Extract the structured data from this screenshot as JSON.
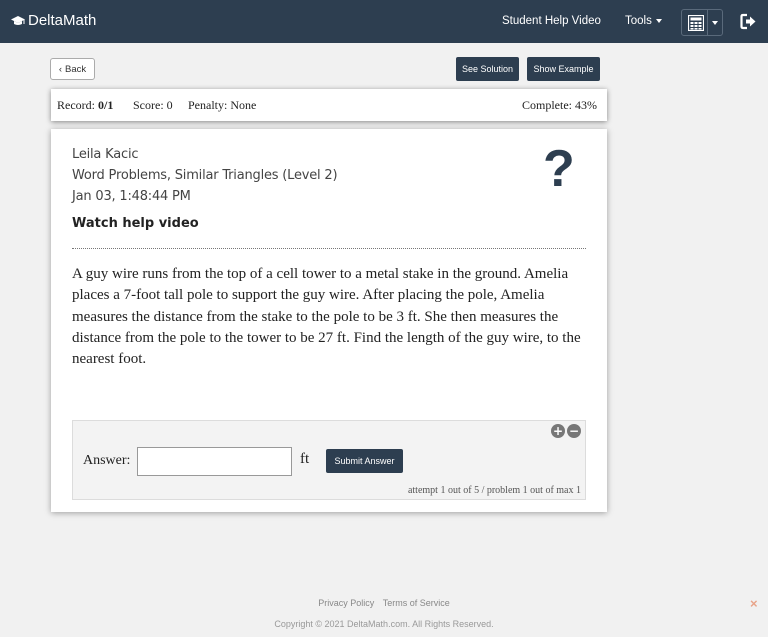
{
  "navbar": {
    "brand": "DeltaMath",
    "student_help_video": "Student Help Video",
    "tools": "Tools"
  },
  "toolbar": {
    "back": "Back",
    "see_solution": "See Solution",
    "show_example": "Show Example"
  },
  "record": {
    "record_label": "Record:",
    "record_value": "0/1",
    "score": "Score: 0",
    "penalty": "Penalty: None",
    "complete": "Complete: 43%"
  },
  "problem": {
    "student_name": "Leila Kacic",
    "topic": "Word Problems, Similar Triangles (Level 2)",
    "date": "Jan 03, 1:48:44 PM",
    "watch_help": "Watch help video",
    "question_icon": "?",
    "text": "A guy wire runs from the top of a cell tower to a metal stake in the ground. Amelia places a 7-foot tall pole to support the guy wire. After placing the pole, Amelia measures the distance from the stake to the pole to be 3 ft. She then measures the distance from the pole to the tower to be 27 ft. Find the length of the guy wire, to the nearest foot."
  },
  "answer": {
    "label": "Answer:",
    "value": "",
    "unit": "ft",
    "submit": "Submit Answer",
    "attempt_info": "attempt 1 out of 5 / problem 1 out of max 1"
  },
  "footer": {
    "privacy": "Privacy Policy",
    "terms": "Terms of Service",
    "copyright": "Copyright © 2021 DeltaMath.com. All Rights Reserved."
  },
  "colors": {
    "navbar_bg": "#2d3e50",
    "button_dark": "#2d3e50",
    "page_bg": "#f1f1f1"
  },
  "icons": [
    "graduation-cap-icon",
    "calculator-icon",
    "logout-icon",
    "chevron-left-icon",
    "question-mark-icon",
    "zoom-in-icon",
    "zoom-out-icon",
    "close-icon"
  ]
}
